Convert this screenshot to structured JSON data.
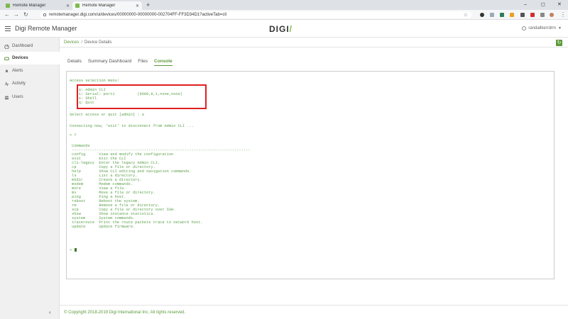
{
  "browser": {
    "tabs": [
      {
        "label": "Remote Manager",
        "active": false
      },
      {
        "label": "Remote Manager",
        "active": true
      }
    ],
    "new_tab": "+",
    "url": "remotemanager.digi.com/ui/devices/00000000-00000000-002704FF-FF3D34D1?activeTab=cli",
    "window_controls": [
      "–",
      "◻",
      "✕"
    ]
  },
  "header": {
    "app_title": "Digi Remote Manager",
    "logo": "DIGI",
    "username": "randallkerrdrm"
  },
  "sidebar": {
    "items": [
      {
        "label": "Dashboard",
        "icon": "dashboard-icon",
        "active": false
      },
      {
        "label": "Devices",
        "icon": "devices-icon",
        "active": true
      },
      {
        "label": "Alerts",
        "icon": "bell-icon",
        "active": false
      },
      {
        "label": "Activity",
        "icon": "activity-icon",
        "active": false
      },
      {
        "label": "Users",
        "icon": "users-icon",
        "active": false
      }
    ],
    "collapse": "‹"
  },
  "breadcrumb": {
    "root": "Devices",
    "separator": "/",
    "current": "Device Details"
  },
  "page_tabs": [
    {
      "label": "Details",
      "active": false
    },
    {
      "label": "Summary Dashboard",
      "active": false
    },
    {
      "label": "Files",
      "active": false
    },
    {
      "label": "Console",
      "active": true
    }
  ],
  "console": {
    "lines": [
      "Access selection menu:",
      "",
      "    a: Admin CLI",
      "    1: Serial: port1          (9600,8,1,none,none)",
      "    s: Shell",
      "    q: Quit",
      "",
      "Select access or quit [admin] : a",
      "",
      "Connecting now, 'exit' to disconnect from Admin CLI ...",
      "",
      "> ?",
      "",
      " Commands",
      " -------------------------------------------------------------------------------",
      " config      View and modify the configuration",
      " exit        Exit the CLI",
      " cli-legacy  Enter the legacy Admin CLI.",
      " cp          Copy a file or directory.",
      " help        Show CLI editing and navigation commands.",
      " ls          List a directory.",
      " mkdir       Create a directory.",
      " modem       Modem commands.",
      " more        View a file.",
      " mv          Move a file or directory.",
      " ping        Ping a host.",
      " reboot      Reboot the system.",
      " rm          Remove a file or directory.",
      " scp         Copy a file or directory over SSH.",
      " show        Show instance statistics.",
      " system      System commands.",
      " traceroute  Print the route packets trace to network host.",
      " update      Update firmware.",
      "",
      "> "
    ]
  },
  "footer": {
    "copyright": "© Copyright 2018-2019 Digi International Inc. All rights reserved."
  },
  "colors": {
    "accent": "#5b9a3a",
    "console_text": "#5ba14a",
    "highlight_box": "#e02020"
  }
}
